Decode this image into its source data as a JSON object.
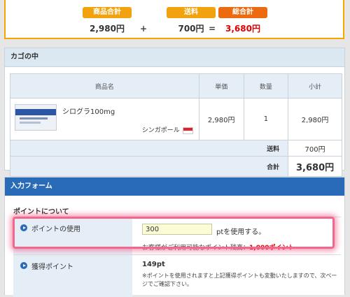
{
  "summary": {
    "subtotal_label": "商品合計",
    "subtotal_value": "2,980円",
    "shipping_label": "送料",
    "shipping_value": "700円",
    "total_label": "総合計",
    "total_value": "3,680円",
    "plus": "+",
    "equals": "="
  },
  "cart": {
    "title": "カゴの中",
    "headers": {
      "product": "商品名",
      "unit_price": "単価",
      "quantity": "数量",
      "subtotal": "小計"
    },
    "item": {
      "name": "シログラ100mg",
      "origin": "シンガポール",
      "unit_price": "2,980円",
      "quantity": "1",
      "subtotal": "2,980円"
    },
    "shipping_label": "送料",
    "shipping_value": "700円",
    "total_label": "合計",
    "total_value": "3,680円"
  },
  "form": {
    "title": "入力フォーム",
    "points_section": "ポイントについて",
    "use_label": "ポイントの使用",
    "use_value": "300",
    "use_suffix": "ptを使用する。",
    "available_text": "お客様がご利用可能なポイント残高：",
    "available_value": "1,000ポイント",
    "earn_label": "獲得ポイント",
    "earn_value": "149pt",
    "earn_note": "※ポイントを使用されますと上記獲得ポイントも変動いたしますので、次ページでご確認下さい。"
  },
  "colors": {
    "accent_orange": "#f3a20f",
    "total_orange": "#ec6a10",
    "blue": "#2a6bb8",
    "red": "#e00000",
    "highlight": "#f2688d"
  }
}
